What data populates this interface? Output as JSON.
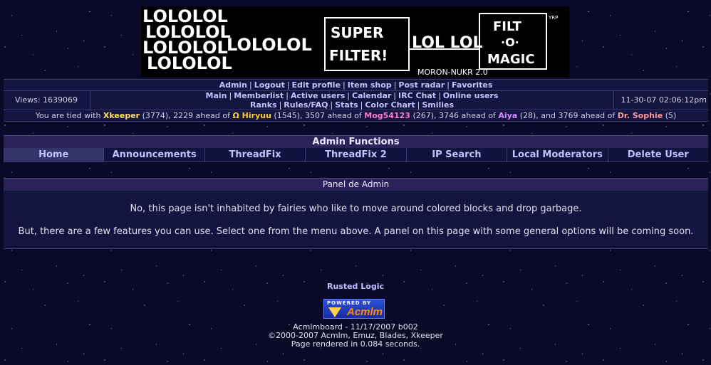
{
  "banner": {
    "texts": [
      "LOLOLOL",
      "LOLOLOL",
      "LOLOLOL",
      "LOLOLOL",
      "LOLOLOL",
      "LOL LOL",
      "SUPER",
      "FILTER!",
      "FILT",
      "·O·",
      "MAGIC",
      "MORON-NUKR 2.0",
      "YRP"
    ]
  },
  "nav_top": [
    "Admin",
    "Logout",
    "Edit profile",
    "Item shop",
    "Post radar",
    "Favorites"
  ],
  "views": "Views: 1639069",
  "nav_main_line1": [
    "Main",
    "Memberlist",
    "Active users",
    "Calendar",
    "IRC Chat",
    "Online users"
  ],
  "nav_main_line2": [
    "Ranks",
    "Rules/FAQ",
    "Stats",
    "Color Chart",
    "Smilies"
  ],
  "datetime": "11-30-07 02:06:12pm",
  "tied": {
    "prefix": "You are tied with",
    "u1": "Xkeeper",
    "u1_rest": "(3774), 2229 ahead of",
    "u2": "Ω Hiryuu",
    "u2_rest": "(1545), 3507 ahead of",
    "u3": "Mog54123",
    "u3_rest": "(267), 3746 ahead of",
    "u4": "Aiya",
    "u4_rest": "(28), and 3769 ahead of",
    "u5": "Dr. Sophie",
    "u5_rest": "(5)",
    "colors": {
      "u1": "#ffe066",
      "u2": "#ffcc33",
      "u3": "#ff7acb",
      "u4": "#d890ff",
      "u5": "#ff9a9a"
    }
  },
  "admin_title": "Admin Functions",
  "tabs": [
    "Home",
    "Announcements",
    "ThreadFix",
    "ThreadFix 2",
    "IP Search",
    "Local Moderators",
    "Delete User"
  ],
  "panel_title": "Panel de Admin",
  "panel_p1": "No, this page isn't inhabited by fairies who like to move around colored blocks and drop garbage.",
  "panel_p2": "But, there are a few features you can use. Select one from the menu above. A panel on this page with some general options will be coming soon.",
  "footer": {
    "sitename": "Rusted Logic",
    "badge_top": "POWERED BY",
    "badge_name": "Acmlm",
    "line1": "Acmlmboard - 11/17/2007 b002",
    "line2": "©2000-2007 Acmlm, Emuz, Blades, Xkeeper",
    "line3": "Page rendered in 0.084 seconds."
  }
}
